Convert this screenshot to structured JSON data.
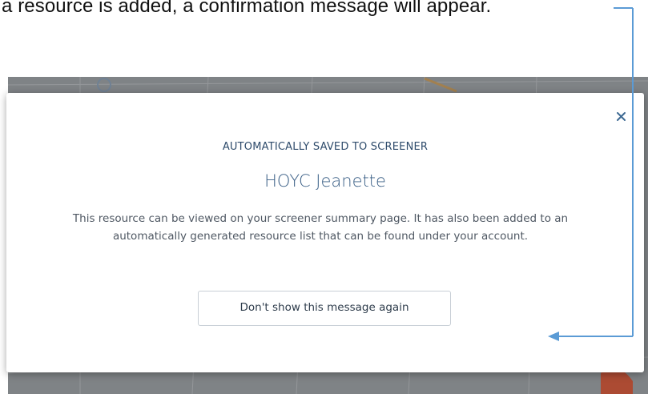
{
  "caption": {
    "text": "a resource is added, a confirmation message will appear."
  },
  "modal": {
    "kicker": "AUTOMATICALLY SAVED TO SCREENER",
    "title": "HOYC Jeanette",
    "body": "This resource can be viewed on your screener summary page. It has also been added to an automatically generated resource list that can be found under your account.",
    "dismiss_label": "Don't show this message again",
    "close_icon": "close-icon"
  },
  "colors": {
    "kicker": "#2e4b6b",
    "title": "#3a5f86",
    "callout": "#5b9bd5",
    "map_pin": "#e8532f"
  }
}
